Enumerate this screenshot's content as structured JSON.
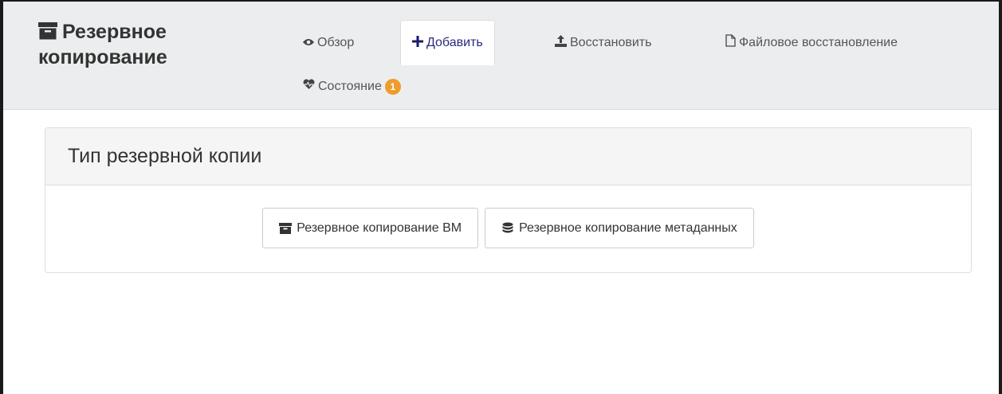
{
  "header": {
    "app_title_line1": "Резервное",
    "app_title_line2": "копирование",
    "title_icon": "archive-icon"
  },
  "tabs": [
    {
      "label": "Обзор",
      "icon": "eye-icon"
    },
    {
      "label": "Добавить",
      "icon": "plus-icon",
      "active": true
    },
    {
      "label": "Восстановить",
      "icon": "upload-icon"
    },
    {
      "label": "Файловое восстановление",
      "icon": "file-icon"
    },
    {
      "label": "Состояние",
      "icon": "heartbeat-icon",
      "badge": "1"
    }
  ],
  "panel": {
    "title": "Тип резервной копии",
    "buttons": [
      {
        "label": "Резервное копирование ВМ",
        "icon": "archive-icon"
      },
      {
        "label": "Резервное копирование метаданных",
        "icon": "database-icon"
      }
    ]
  },
  "colors": {
    "header_bg": "#ecedee",
    "active_tab_text": "#2b2a7d",
    "badge_bg": "#ee9c2c",
    "panel_heading_bg": "#f5f5f5"
  }
}
